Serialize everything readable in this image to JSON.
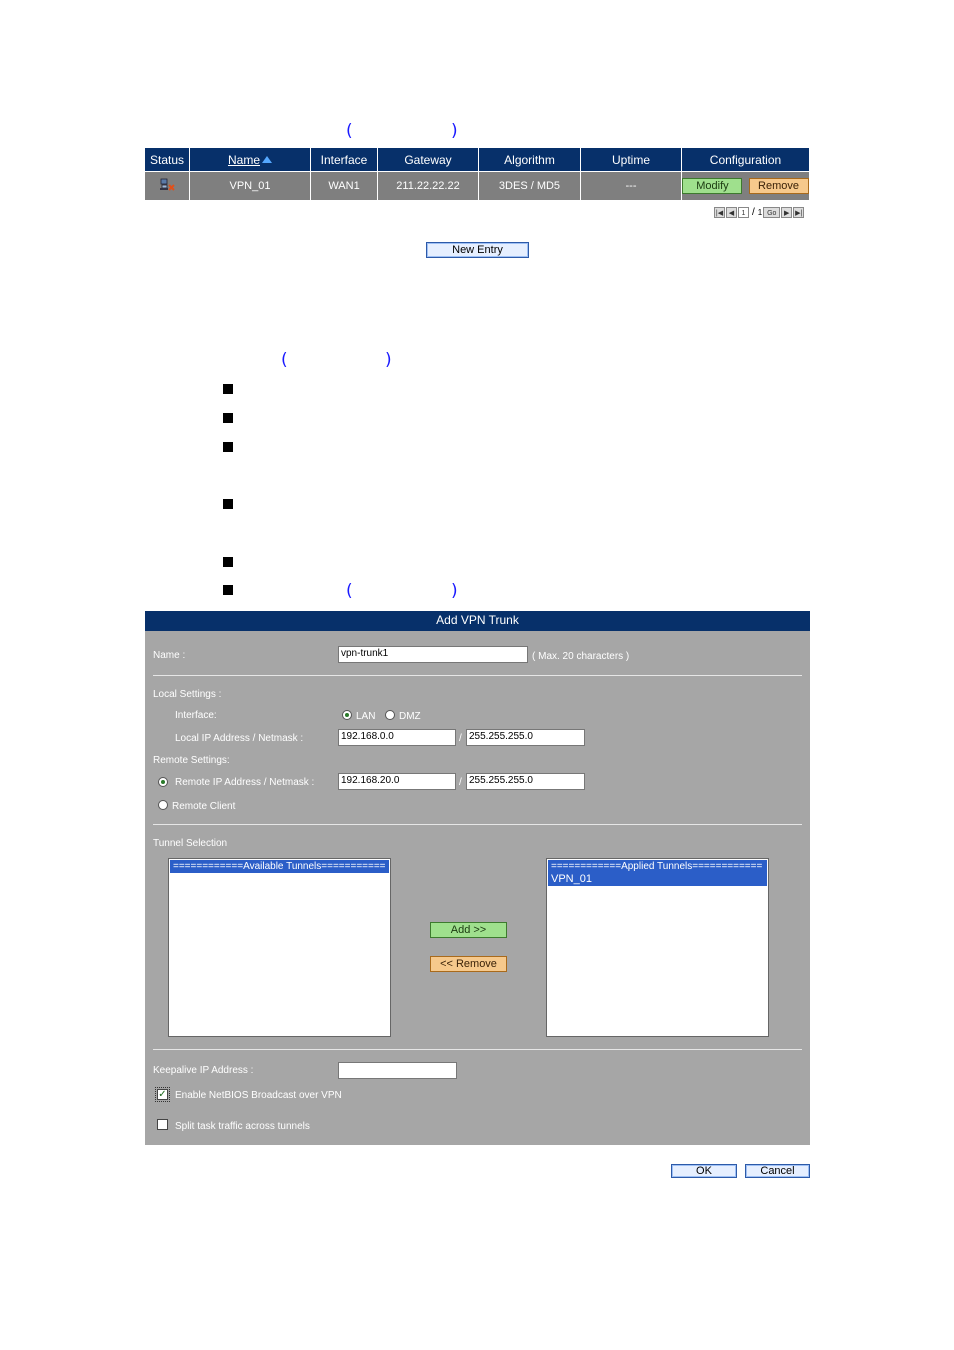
{
  "vpn_table": {
    "columns": [
      "Status",
      "Name",
      "Interface",
      "Gateway",
      "Algorithm",
      "Uptime",
      "Configuration"
    ],
    "rows": [
      {
        "name": "VPN_01",
        "interface": "WAN1",
        "gateway": "211.22.22.22",
        "algorithm": "3DES / MD5",
        "uptime": "---",
        "modify": "Modify",
        "remove": "Remove"
      }
    ]
  },
  "pager": {
    "page": "1",
    "sep": "/",
    "total": "1",
    "go": "Go"
  },
  "new_entry_label": "New Entry",
  "paren_open": "(",
  "paren_close": ")",
  "panel": {
    "title": "Add VPN Trunk",
    "name_label": "Name :",
    "name_value": "vpn-trunk1",
    "name_hint": "( Max. 20 characters )",
    "local_settings": "Local Settings :",
    "interface_label": "Interface:",
    "lan": "LAN",
    "dmz": "DMZ",
    "local_ip_label": "Local IP Address / Netmask :",
    "local_ip": "192.168.0.0",
    "local_mask": "255.255.255.0",
    "slash": "/",
    "remote_settings": "Remote Settings:",
    "remote_ip_label": "Remote IP Address / Netmask :",
    "remote_ip": "192.168.20.0",
    "remote_mask": "255.255.255.0",
    "remote_client": "Remote Client",
    "tunnel_selection": "Tunnel Selection",
    "available_header": "============Available Tunnels===========",
    "applied_header": "============Applied Tunnels============",
    "applied_items": [
      "VPN_01"
    ],
    "add_btn": "Add >>",
    "remove_btn": "<< Remove",
    "keepalive_label": "Keepalive IP Address :",
    "keepalive_value": "",
    "netbios_label": "Enable NetBIOS Broadcast over VPN",
    "netbios_checked": true,
    "split_label": "Split task traffic across tunnels",
    "split_checked": false
  },
  "ok_label": "OK",
  "cancel_label": "Cancel"
}
